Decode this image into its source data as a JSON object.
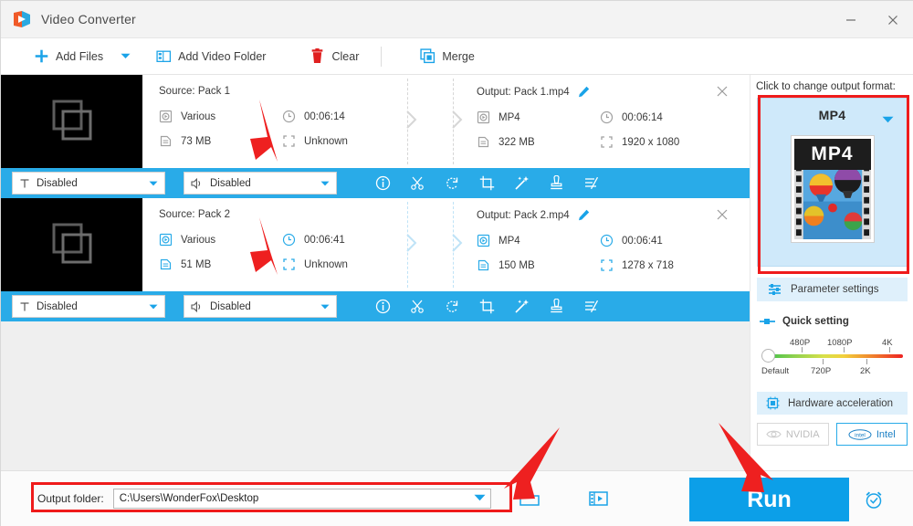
{
  "window": {
    "title": "Video Converter",
    "minimize_label": "–",
    "close_label": "✕"
  },
  "toolbar": {
    "add_files": "Add Files",
    "add_video_folder": "Add Video Folder",
    "clear": "Clear",
    "merge": "Merge"
  },
  "files": [
    {
      "source_label": "Source: Pack 1",
      "source_format": "Various",
      "source_duration": "00:06:14",
      "source_size": "73 MB",
      "source_resolution": "Unknown",
      "output_label": "Output: Pack 1.mp4",
      "output_format": "MP4",
      "output_duration": "00:06:14",
      "output_size": "322 MB",
      "output_resolution": "1920 x 1080",
      "subtitle_value": "Disabled",
      "audio_value": "Disabled",
      "selected": false
    },
    {
      "source_label": "Source: Pack 2",
      "source_format": "Various",
      "source_duration": "00:06:41",
      "source_size": "51 MB",
      "source_resolution": "Unknown",
      "output_label": "Output: Pack 2.mp4",
      "output_format": "MP4",
      "output_duration": "00:06:41",
      "output_size": "150 MB",
      "output_resolution": "1278 x 718",
      "subtitle_value": "Disabled",
      "audio_value": "Disabled",
      "selected": true
    }
  ],
  "row_tools": [
    "info-icon",
    "cut-scissors-icon",
    "rotate-icon",
    "crop-icon",
    "magic-wand-effects-icon",
    "watermark-stamp-icon",
    "compress-settings-icon"
  ],
  "right_panel": {
    "hint": "Click to change output format:",
    "format_name": "MP4",
    "format_badge": "MP4",
    "parameter_settings": "Parameter settings",
    "quick_setting": "Quick setting",
    "slider": {
      "labels_above": [
        "480P",
        "1080P",
        "4K"
      ],
      "labels_below": [
        "Default",
        "720P",
        "2K"
      ],
      "current": "Default"
    },
    "hardware_acceleration": "Hardware acceleration",
    "gpu_nvidia": "NVIDIA",
    "gpu_intel": "Intel"
  },
  "bottom": {
    "output_folder_label": "Output folder:",
    "output_folder_value": "C:\\Users\\WonderFox\\Desktop",
    "open_folder_icon": "folder-icon",
    "media_icon": "media-library-icon",
    "run_label": "Run",
    "schedule_icon": "alarm-clock-icon"
  },
  "colors": {
    "accent_blue": "#29abe8",
    "run_blue": "#0c9fe8",
    "highlight_red": "#ef1b1b",
    "panel_blue": "#cfe9fa"
  }
}
